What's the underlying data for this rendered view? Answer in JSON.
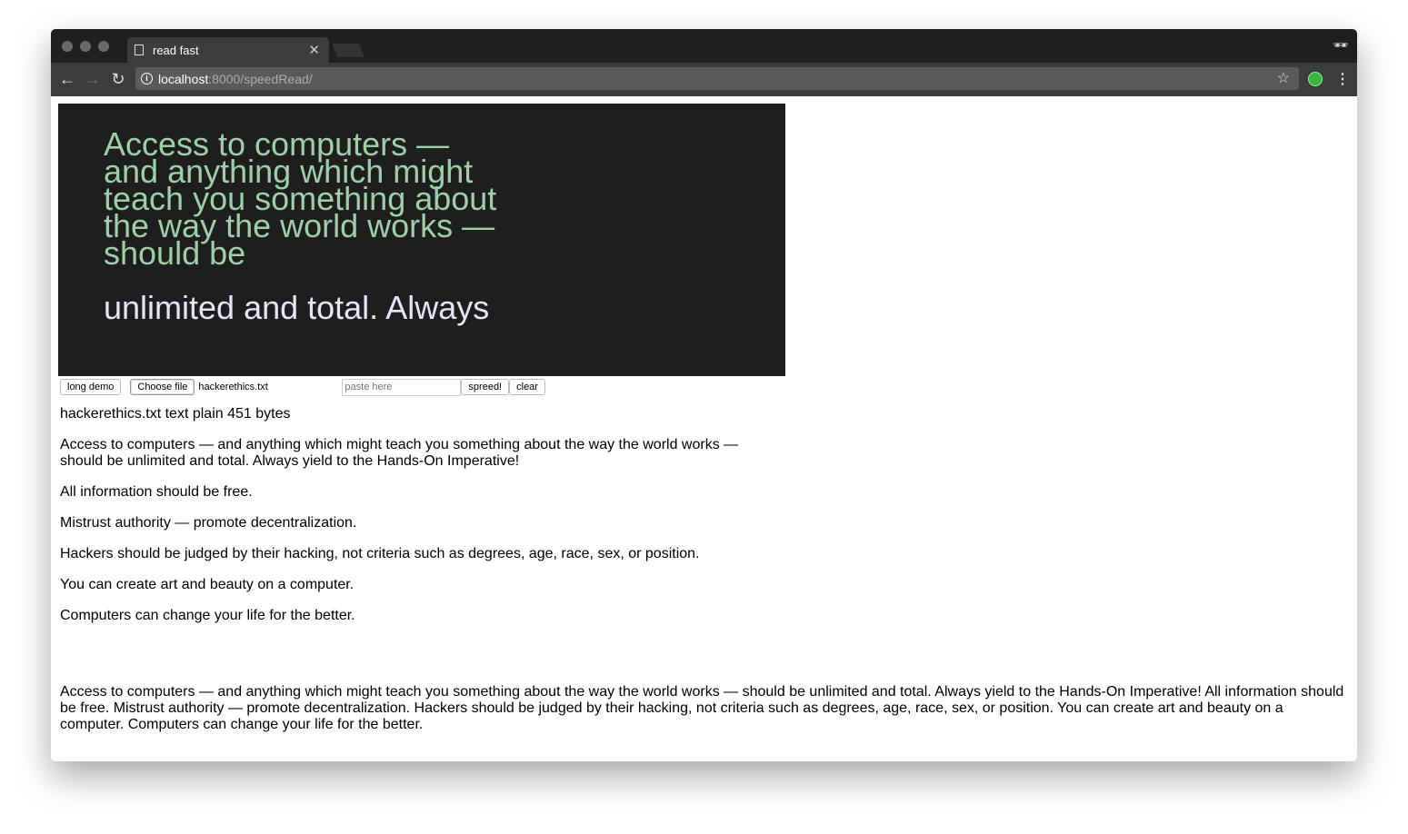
{
  "browser": {
    "tab_title": "read fast",
    "url_host": "localhost",
    "url_rest": ":8000/speedRead/"
  },
  "display": {
    "past_text": "Access to computers — and anything which might teach you something about the way the world works — should be",
    "current_text": "unlimited and total. Always"
  },
  "controls": {
    "long_demo": "long demo",
    "choose_file": "Choose file",
    "file_name": "hackerethics.txt",
    "paste_placeholder": "paste here",
    "spreed": "spreed!",
    "clear": "clear"
  },
  "file_meta": "hackerethics.txt text plain 451 bytes",
  "paragraphs": [
    "Access to computers — and anything which might teach you something about the way the world works — should be unlimited and total. Always yield to the Hands-On Imperative!",
    "All information should be free.",
    "Mistrust authority — promote decentralization.",
    "Hackers should be judged by their hacking, not criteria such as degrees, age, race, sex, or position.",
    "You can create art and beauty on a computer.",
    "Computers can change your life for the better."
  ],
  "full_text": "Access to computers — and anything which might teach you something about the way the world works — should be unlimited and total. Always yield to the Hands-On Imperative! All information should be free. Mistrust authority — promote decentralization. Hackers should be judged by their hacking, not criteria such as degrees, age, race, sex, or position. You can create art and beauty on a computer. Computers can change your life for the better."
}
